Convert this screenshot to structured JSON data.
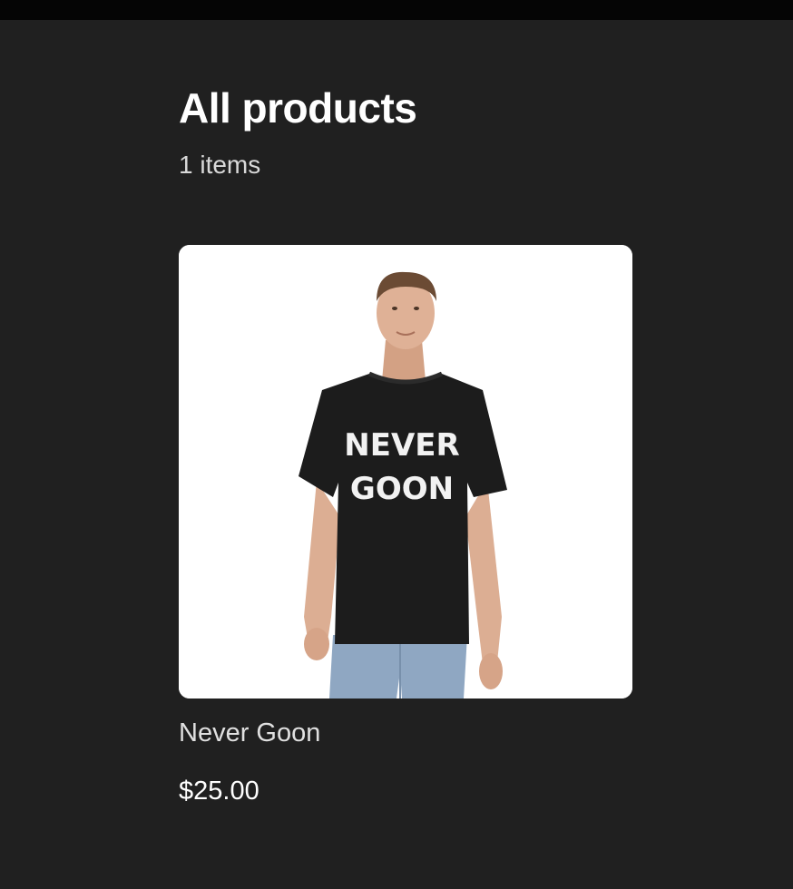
{
  "header": {
    "title": "All products",
    "item_count": "1 items"
  },
  "products": [
    {
      "name": "Never Goon",
      "price": "$25.00",
      "image": {
        "shirt_text_line1": "NEVER",
        "shirt_text_line2": "GOON",
        "shirt_color": "#1c1c1c",
        "print_color": "#f2f2f2"
      }
    }
  ],
  "colors": {
    "background": "#202020",
    "topbar": "#050505",
    "card": "#ffffff"
  }
}
